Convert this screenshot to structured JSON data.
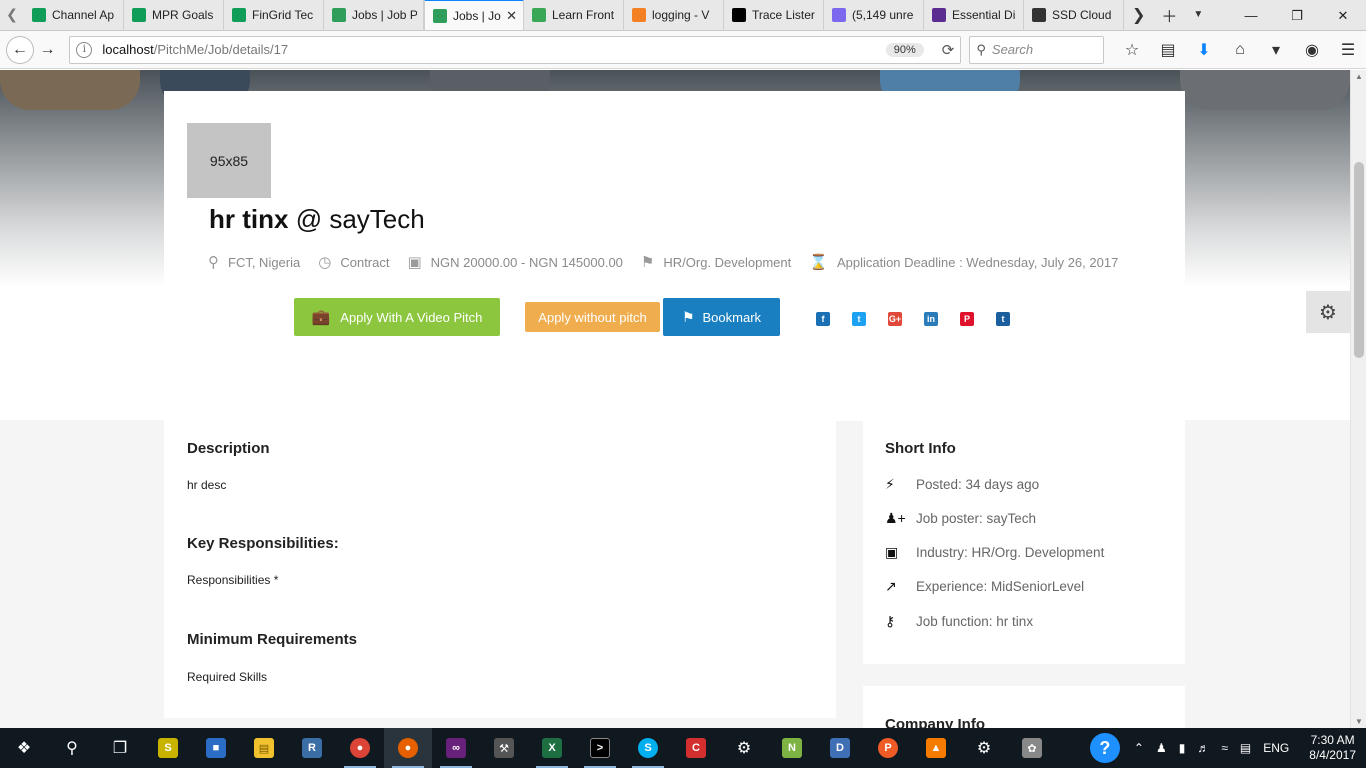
{
  "browser": {
    "tabs": [
      {
        "title": "Channel Ap",
        "favicon": "sheets-icon",
        "color": "#0f9d58"
      },
      {
        "title": "MPR Goals",
        "favicon": "sheets-icon",
        "color": "#0f9d58"
      },
      {
        "title": "FinGrid Tec",
        "favicon": "sheets-icon",
        "color": "#0f9d58"
      },
      {
        "title": "Jobs | Job P",
        "favicon": "pitchme-icon",
        "color": "#2e9e5a"
      },
      {
        "title": "Jobs | Jo",
        "favicon": "pitchme-icon",
        "color": "#2e9e5a",
        "active": true
      },
      {
        "title": "Learn Front",
        "favicon": "learn-icon",
        "color": "#3aa757"
      },
      {
        "title": "logging - V",
        "favicon": "stackoverflow-icon",
        "color": "#f48024"
      },
      {
        "title": "Trace Lister",
        "favicon": "medium-icon",
        "color": "#000000"
      },
      {
        "title": "(5,149 unre",
        "favicon": "mail-icon",
        "color": "#7b68ee"
      },
      {
        "title": "Essential Di",
        "favicon": "essential-icon",
        "color": "#5c2d91"
      },
      {
        "title": "SSD Cloud",
        "favicon": "cloud-icon",
        "color": "#333333"
      }
    ],
    "url_host": "localhost",
    "url_path": "/PitchMe/Job/details/17",
    "zoom": "90%",
    "search_placeholder": "Search"
  },
  "job": {
    "logo_placeholder": "95x85",
    "title": "hr tinx",
    "at": "@",
    "company": "sayTech",
    "location": "FCT, Nigeria",
    "type": "Contract",
    "salary": "NGN 20000.00 - NGN 145000.00",
    "category": "HR/Org. Development",
    "deadline": "Application Deadline : Wednesday, July 26, 2017"
  },
  "actions": {
    "apply_video": "Apply With A Video Pitch",
    "apply_no_pitch": "Apply without pitch",
    "bookmark": "Bookmark"
  },
  "social": [
    {
      "name": "facebook-icon",
      "glyph": "f",
      "color": "#1a6fb5"
    },
    {
      "name": "twitter-icon",
      "glyph": "t",
      "color": "#1da1f2"
    },
    {
      "name": "googleplus-icon",
      "glyph": "G+",
      "color": "#e0493a"
    },
    {
      "name": "linkedin-icon",
      "glyph": "in",
      "color": "#2b7bb9"
    },
    {
      "name": "pinterest-icon",
      "glyph": "P",
      "color": "#e0112b"
    },
    {
      "name": "tumblr-icon",
      "glyph": "t",
      "color": "#1b5e9e"
    }
  ],
  "description": {
    "heading": "Description",
    "text": "hr desc",
    "responsibilities_heading": "Key Responsibilities:",
    "responsibilities_text": "Responsibilities *",
    "requirements_heading": "Minimum Requirements",
    "requirements_text": "Required Skills"
  },
  "short_info": {
    "heading": "Short Info",
    "posted": "Posted: 34 days ago",
    "poster": "Job poster: sayTech",
    "industry": "Industry: HR/Org. Development",
    "experience": "Experience: MidSeniorLevel",
    "function": "Job function: hr tinx"
  },
  "company_info": {
    "heading": "Company Info"
  },
  "taskbar": {
    "language": "ENG",
    "time": "7:30 AM",
    "date": "8/4/2017"
  }
}
